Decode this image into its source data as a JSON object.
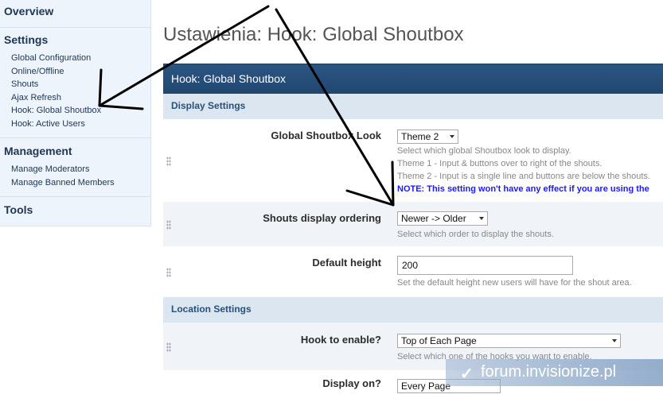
{
  "sidebar": {
    "overview": "Overview",
    "settings": {
      "heading": "Settings",
      "items": [
        "Global Configuration",
        "Online/Offline",
        "Shouts",
        "Ajax Refresh",
        "Hook: Global Shoutbox",
        "Hook: Active Users"
      ]
    },
    "management": {
      "heading": "Management",
      "items": [
        "Manage Moderators",
        "Manage Banned Members"
      ]
    },
    "tools": "Tools"
  },
  "page_title": "Ustawienia: Hook: Global Shoutbox",
  "panel": {
    "title": "Hook: Global Shoutbox",
    "display_settings": "Display Settings",
    "look": {
      "label": "Global Shoutbox Look",
      "value": "Theme 2",
      "desc1": "Select which global Shoutbox look to display.",
      "desc2": "Theme 1 - Input & buttons over to right of the shouts.",
      "desc3": "Theme 2 - Input is a single line and buttons are below the shouts.",
      "note": "NOTE: This setting won't have any effect if you are using the"
    },
    "ordering": {
      "label": "Shouts display ordering",
      "value": "Newer -> Older",
      "desc": "Select which order to display the shouts."
    },
    "height": {
      "label": "Default height",
      "value": "200",
      "desc": "Set the default height new users will have for the shout area."
    },
    "location_settings": "Location Settings",
    "hook": {
      "label": "Hook to enable?",
      "value": "Top of Each Page",
      "desc": "Select which one of the hooks you want to enable."
    },
    "display_on": {
      "label": "Display on?",
      "value": "Every Page"
    }
  },
  "watermark": "forum.invisionize.pl",
  "colors": {
    "header": "#23507c",
    "subhead": "#dbe6f1",
    "link": "#1d3652",
    "note": "#1a1aff"
  }
}
